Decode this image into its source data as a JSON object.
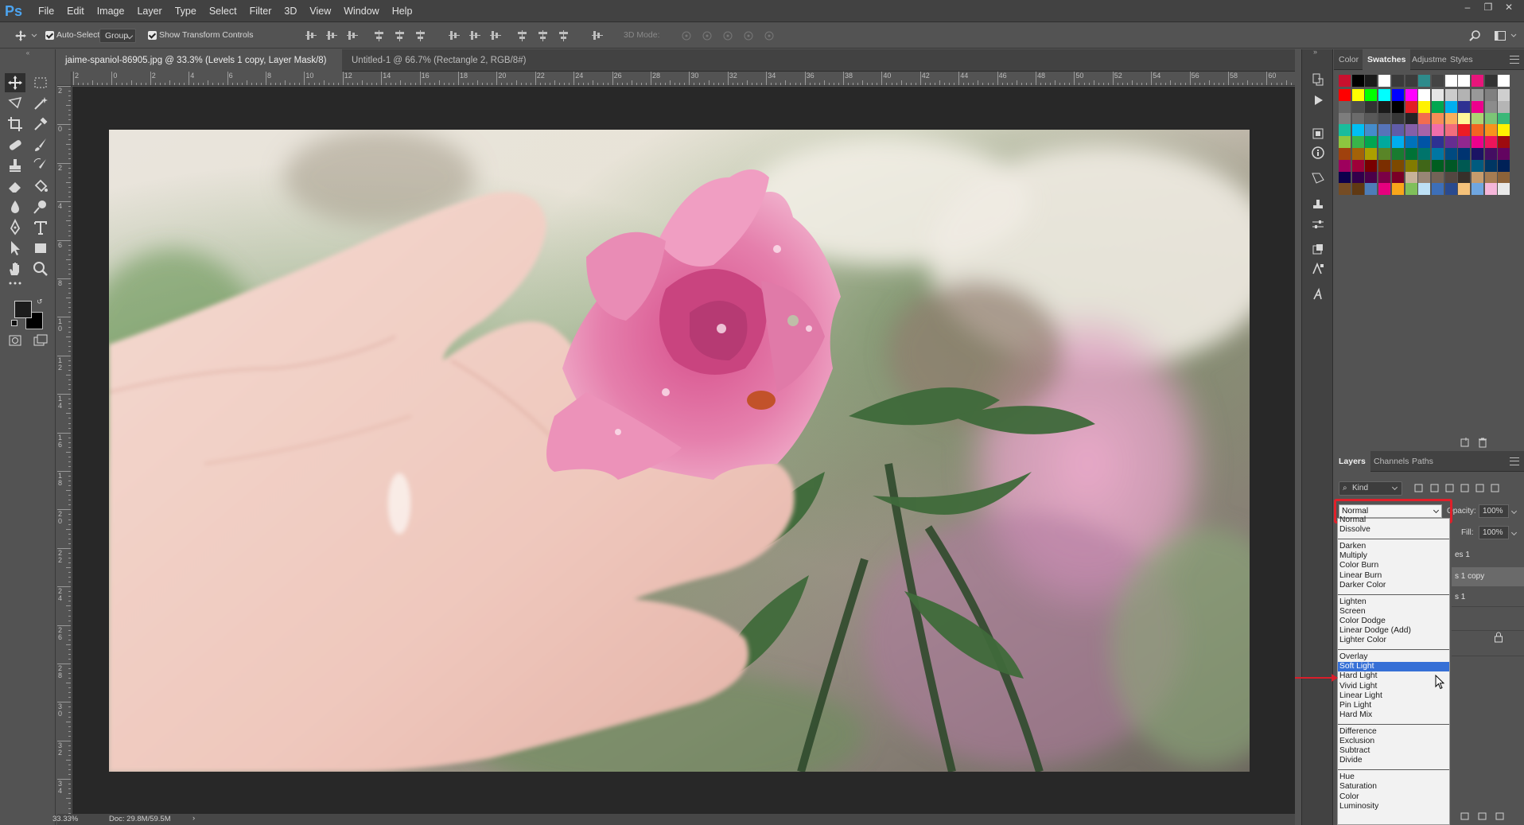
{
  "app": {
    "logo": "Ps",
    "name": "Adobe Photoshop"
  },
  "menu": [
    "File",
    "Edit",
    "Image",
    "Layer",
    "Type",
    "Select",
    "Filter",
    "3D",
    "View",
    "Window",
    "Help"
  ],
  "window_controls": [
    "minimize-icon",
    "restore-icon",
    "close-icon"
  ],
  "options_bar": {
    "auto_select_label": "Auto-Select:",
    "auto_select_checked": true,
    "group_value": "Group",
    "show_transform_label": "Show Transform Controls",
    "show_transform_checked": true,
    "mode_3d_label": "3D Mode:"
  },
  "tabs": [
    {
      "label": "jaime-spaniol-86905.jpg @ 33.3% (Levels 1 copy, Layer Mask/8) *",
      "active": true
    },
    {
      "label": "Untitled-1 @ 66.7% (Rectangle 2, RGB/8#) *",
      "active": false
    }
  ],
  "tab_close": "×",
  "ruler_top_labels": [
    "2",
    "0",
    "2",
    "4",
    "6",
    "8",
    "10",
    "12",
    "14",
    "16",
    "18",
    "20",
    "22",
    "24",
    "26",
    "28",
    "30",
    "32",
    "34",
    "36",
    "38",
    "40",
    "42",
    "44",
    "46",
    "48",
    "50",
    "52",
    "54",
    "56",
    "58",
    "60"
  ],
  "ruler_left_labels": [
    "2",
    "0",
    "2",
    "4",
    "6",
    "8",
    "1 0",
    "1 2",
    "1 4",
    "1 6",
    "1 8",
    "2 0",
    "2 2",
    "2 4",
    "2 6",
    "2 8",
    "3 0",
    "3 2",
    "3 4"
  ],
  "status": {
    "zoom": "33.33%",
    "doc": "Doc: 29.8M/59.5M",
    "arrow": "›"
  },
  "panels": {
    "top_tabs": [
      "Color",
      "Swatches",
      "Adjustme",
      "Styles"
    ],
    "top_active": "Swatches",
    "layers_tabs": [
      "Layers",
      "Channels",
      "Paths"
    ],
    "layers_active": "Layers",
    "kind_label": "Kind",
    "opacity_label": "Opacity:",
    "opacity_value": "100%",
    "fill_label": "Fill:",
    "fill_value": "100%",
    "layer_rows": [
      "es 1",
      "s 1 copy",
      "s 1"
    ]
  },
  "swatches": [
    [
      "#c8102e",
      "#000000",
      "#1a1a1a",
      "#ffffff",
      "#3a3a3a",
      "#3c3c3c",
      "#2e8b8b",
      "#444444",
      "#ffffff",
      "#ffffff",
      "#e8157b",
      "#333333",
      "#ffffff"
    ],
    [
      "#ff0000",
      "#ffff00",
      "#00ff00",
      "#00ffff",
      "#0000ff",
      "#ff00ff",
      "#ffffff",
      "#e6e6e6",
      "#cccccc",
      "#b3b3b3",
      "#999999",
      "#808080",
      "#cfcfcf"
    ],
    [
      "#666666",
      "#4d4d4d",
      "#333333",
      "#1a1a1a",
      "#000000",
      "#e31e24",
      "#fff200",
      "#00a650",
      "#00aeef",
      "#2e3192",
      "#ec008c",
      "#8c8c8c",
      "#b5b5b5"
    ],
    [
      "#7d7d7d",
      "#6b6b6b",
      "#595959",
      "#474747",
      "#363636",
      "#242424",
      "#f26c4f",
      "#f68e56",
      "#fbaf5d",
      "#fff799",
      "#acd373",
      "#7cc576",
      "#3bb878"
    ],
    [
      "#1abc9c",
      "#00bff3",
      "#448ccb",
      "#5674b9",
      "#605ca8",
      "#855fa8",
      "#a763a8",
      "#f06eaa",
      "#f26d7d",
      "#ed1c24",
      "#f26522",
      "#f7941d",
      "#fff200"
    ],
    [
      "#8dc63f",
      "#39b54a",
      "#00a651",
      "#00a99d",
      "#00aeef",
      "#0072bc",
      "#0054a6",
      "#2e3192",
      "#662d91",
      "#92278f",
      "#ec008c",
      "#ed145b",
      "#9e0b0f"
    ],
    [
      "#a0410d",
      "#a36209",
      "#aba000",
      "#598527",
      "#197b30",
      "#007236",
      "#00746b",
      "#0076a3",
      "#004a80",
      "#003471",
      "#1b1464",
      "#440e62",
      "#630460"
    ],
    [
      "#9e005d",
      "#9e0039",
      "#790000",
      "#7b2e00",
      "#7d4900",
      "#827b00",
      "#406618",
      "#005e20",
      "#005826",
      "#005952",
      "#005b7f",
      "#003663",
      "#002157"
    ],
    [
      "#0d004c",
      "#32004b",
      "#4b0049",
      "#7b0046",
      "#7a0026",
      "#c7b299",
      "#998675",
      "#736357",
      "#534741",
      "#37302a",
      "#c69c6d",
      "#a67c52",
      "#8c6239"
    ],
    [
      "#754c24",
      "#603913",
      "#4d7db8",
      "#e6007e",
      "#f9a61a",
      "#7fbf5a",
      "#bde0f5",
      "#3d6fb8",
      "#2a4a8e",
      "#f5c27a",
      "#6fa6e0",
      "#f5b6d9",
      "#e8e8e8"
    ]
  ],
  "blend_modes": {
    "current": "Normal",
    "groups": [
      [
        "Normal",
        "Dissolve"
      ],
      [
        "Darken",
        "Multiply",
        "Color Burn",
        "Linear Burn",
        "Darker Color"
      ],
      [
        "Lighten",
        "Screen",
        "Color Dodge",
        "Linear Dodge (Add)",
        "Lighter Color"
      ],
      [
        "Overlay",
        "Soft Light",
        "Hard Light",
        "Vivid Light",
        "Linear Light",
        "Pin Light",
        "Hard Mix"
      ],
      [
        "Difference",
        "Exclusion",
        "Subtract",
        "Divide"
      ],
      [
        "Hue",
        "Saturation",
        "Color",
        "Luminosity"
      ]
    ],
    "highlighted": "Soft Light"
  },
  "accent_colors": {
    "highlight": "#e0202a",
    "selection": "#3670d6",
    "ps_blue": "#4ca4f0"
  }
}
